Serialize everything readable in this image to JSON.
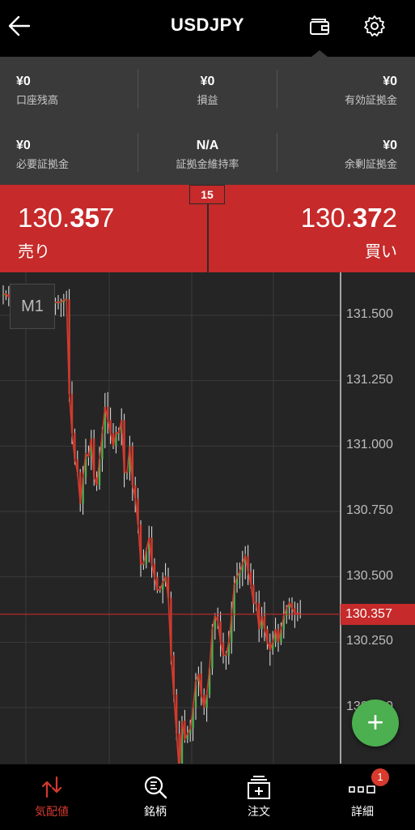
{
  "header": {
    "title": "USDJPY",
    "back_icon": "back-arrow-icon",
    "wallet_icon": "wallet-icon",
    "settings_icon": "gear-icon"
  },
  "stats": [
    {
      "value": "¥0",
      "label": "口座残高"
    },
    {
      "value": "¥0",
      "label": "損益"
    },
    {
      "value": "¥0",
      "label": "有効証拠金"
    },
    {
      "value": "¥0",
      "label": "必要証拠金"
    },
    {
      "value": "N/A",
      "label": "証拠金維持率"
    },
    {
      "value": "¥0",
      "label": "余剰証拠金"
    }
  ],
  "price": {
    "spread": "15",
    "bid": {
      "pre": "130.",
      "big": "35",
      "post": "7",
      "label": "売り"
    },
    "ask": {
      "pre": "130.",
      "big": "37",
      "post": "2",
      "label": "買い"
    }
  },
  "chart": {
    "timeframe": "M1",
    "last_price": "130.357",
    "y_labels": [
      "131.500",
      "131.250",
      "131.000",
      "130.750",
      "130.500",
      "130.250",
      "130.000"
    ],
    "colors": {
      "up": "#4caf50",
      "down": "#d03a2e",
      "wick": "#e8e8e8",
      "grid": "#3a3a3a",
      "last_line": "#c62a2a"
    }
  },
  "chart_data": {
    "type": "candlestick",
    "y_ticks": [
      131.5,
      131.25,
      131.0,
      130.75,
      130.5,
      130.25,
      130.0
    ],
    "ylim": [
      129.8,
      131.65
    ],
    "last_price": 130.357,
    "close_series": [
      131.58,
      131.58,
      131.57,
      131.57,
      131.57,
      131.56,
      131.57,
      131.56,
      131.56,
      131.56,
      131.56,
      131.56,
      131.56,
      131.56,
      131.56,
      131.55,
      131.56,
      131.56,
      131.55,
      131.55,
      131.55,
      131.55,
      131.56,
      131.56,
      131.2,
      131.05,
      130.95,
      130.9,
      130.78,
      130.88,
      130.97,
      130.96,
      131.03,
      130.88,
      130.85,
      130.95,
      131.05,
      131.15,
      131.1,
      131.05,
      131.0,
      131.05,
      131.05,
      131.1,
      130.9,
      130.9,
      131.0,
      130.85,
      130.8,
      130.7,
      130.55,
      130.55,
      130.6,
      130.65,
      130.55,
      130.5,
      130.45,
      130.45,
      130.48,
      130.5,
      130.42,
      130.2,
      130.05,
      129.9,
      129.75,
      129.95,
      129.88,
      129.9,
      129.92,
      130.0,
      130.1,
      130.13,
      130.05,
      130.0,
      130.05,
      130.15,
      130.3,
      130.35,
      130.33,
      130.25,
      130.2,
      130.2,
      130.25,
      130.35,
      130.47,
      130.5,
      130.52,
      130.55,
      130.58,
      130.52,
      130.47,
      130.4,
      130.4,
      130.3,
      130.35,
      130.3,
      130.25,
      130.22,
      130.25,
      130.3,
      130.25,
      130.3,
      130.35,
      130.38,
      130.4,
      130.38,
      130.36,
      130.36,
      130.36
    ]
  },
  "nav": [
    {
      "label": "気配値",
      "icon": "quote-arrows-icon",
      "active": true
    },
    {
      "label": "銘柄",
      "icon": "search-list-icon",
      "active": false
    },
    {
      "label": "注文",
      "icon": "order-icon",
      "active": false
    },
    {
      "label": "詳細",
      "icon": "more-dots-icon",
      "active": false
    }
  ],
  "badge": "1",
  "fab": "+"
}
